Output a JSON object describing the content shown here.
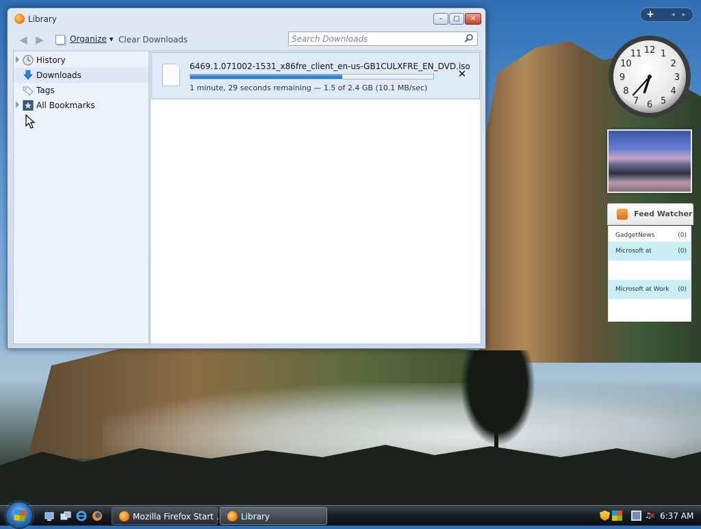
{
  "window": {
    "title": "Library",
    "buttons": {
      "minimize": "–",
      "maximize": "□",
      "close": "✕"
    }
  },
  "toolbar": {
    "back_icon": "back-arrow-icon",
    "forward_icon": "forward-arrow-icon",
    "organize_label": "Organize",
    "organize_arrow": "▾",
    "clear_downloads_label": "Clear Downloads",
    "search_placeholder": "Search Downloads"
  },
  "sidebar": {
    "items": [
      {
        "label": "History",
        "icon": "clock-icon",
        "expandable": true
      },
      {
        "label": "Downloads",
        "icon": "download-arrow-icon",
        "expandable": false,
        "selected": true
      },
      {
        "label": "Tags",
        "icon": "tag-icon",
        "expandable": false
      },
      {
        "label": "All Bookmarks",
        "icon": "bookmark-icon",
        "expandable": true
      }
    ]
  },
  "download": {
    "file_name": "6469.1.071002-1531_x86fre_client_en-us-GB1CULXFRE_EN_DVD.iso",
    "progress_fraction": 0.625,
    "status": "1 minute, 29 seconds remaining — 1.5 of 2.4 GB (10.1 MB/sec)",
    "cancel_label": "✕"
  },
  "gadgets": {
    "toolbar": {
      "add_label": "+",
      "prev_label": "◂",
      "next_label": "▸"
    },
    "clock": {
      "hour": 6,
      "minute": 37
    },
    "feed_watcher": {
      "title": "Feed Watcher",
      "items": [
        {
          "name": "GadgetNews",
          "count": "(0)",
          "highlight": false
        },
        {
          "name": "Microsoft at",
          "count": "(0)",
          "highlight": true
        },
        {
          "name": "Microsoft at Work",
          "count": "(0)",
          "highlight": true
        }
      ]
    }
  },
  "taskbar": {
    "tasks": [
      {
        "label": "Mozilla Firefox Start ..."
      },
      {
        "label": "Library"
      }
    ],
    "time": "6:37 AM"
  },
  "colors": {
    "accent": "#1f6fd1",
    "selection": "#dfeaf7",
    "taskbar": "#1a1f24"
  }
}
